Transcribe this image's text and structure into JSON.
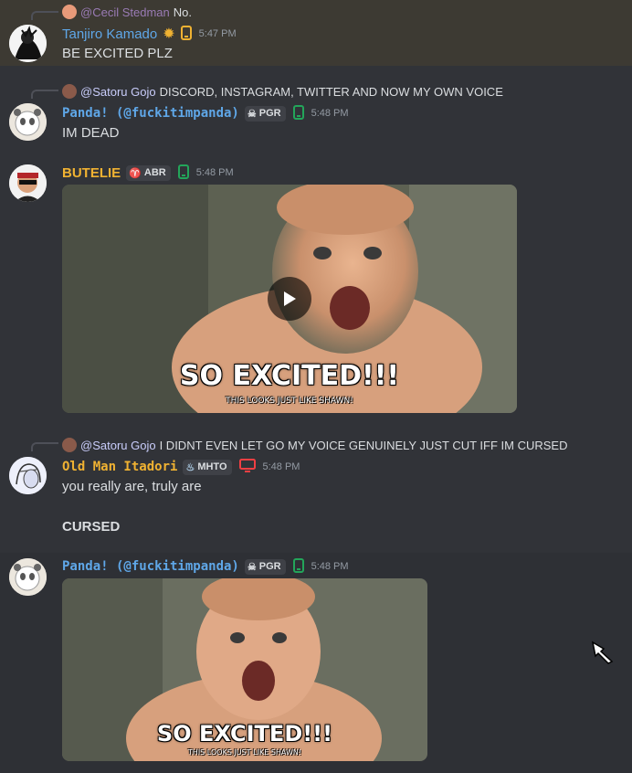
{
  "colors": {
    "background": "#313338",
    "highlight": "#3d3a33",
    "mention": "#c9cdfb",
    "username_blue": "#5fa7e8",
    "username_gold": "#f0b232",
    "timestamp": "#949ba4",
    "mobile_green": "#23a55a",
    "desktop_red": "#f23f43",
    "mobile_orange": "#f0b232"
  },
  "messages": [
    {
      "reply": {
        "user": "@Cecil Stedman",
        "text": "No."
      },
      "author": "Tanjiro Kamado",
      "icon": "sunflower-icon",
      "device": "mobile-icon",
      "time": "5:47 PM",
      "text": "BE EXCITED PLZ"
    },
    {
      "reply": {
        "user": "@Satoru Gojo",
        "text": "DISCORD, INSTAGRAM, TWITTER AND NOW MY OWN VOICE"
      },
      "author": "Panda! (@fuckitimpanda)",
      "tag": "PGR",
      "tag_icon": "skull-icon",
      "device": "mobile-icon",
      "time": "5:48 PM",
      "text": "IM DEAD"
    },
    {
      "author": "BUTELIE",
      "tag": "ABR",
      "tag_icon": "horns-icon",
      "device": "mobile-icon",
      "time": "5:48 PM",
      "gif": {
        "caption": "SO EXCITED!!!",
        "subcaption": "THIS LOOKS JUST LIKE SHAWN!"
      }
    },
    {
      "reply": {
        "user": "@Satoru Gojo",
        "text": "I DIDNT EVEN LET GO MY VOICE GENUINELY JUST CUT IFF IM CURSED"
      },
      "author": "Old Man Itadori",
      "tag": "MHTO",
      "tag_icon": "flame-icon",
      "device": "desktop-icon",
      "time": "5:48 PM",
      "text": "you really are, truly are",
      "text2": "CURSED"
    },
    {
      "author": "Panda! (@fuckitimpanda)",
      "tag": "PGR",
      "tag_icon": "skull-icon",
      "device": "mobile-icon",
      "time": "5:48 PM",
      "gif": {
        "caption": "SO EXCITED!!!",
        "subcaption": "THIS LOOKS JUST LIKE SHAWN!"
      }
    }
  ]
}
